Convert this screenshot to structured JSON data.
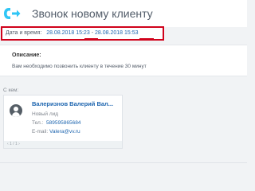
{
  "header": {
    "title": "Звонок новому клиенту",
    "icon": "outgoing-call-icon",
    "icon_color": "#2fc6f6"
  },
  "datetime": {
    "label": "Дата и время:",
    "start_date": "28.08.2018",
    "start_time": "15:23",
    "separator": "-",
    "end_date": "28.08.2018",
    "end_time": "15:53",
    "highlight_color": "#d0021b"
  },
  "description": {
    "label": "Описание:",
    "text": "Вам необходимо позвонить клиенту в течение 30 минут"
  },
  "with": {
    "label": "С кем:"
  },
  "contact": {
    "name": "Валеризнов Валерий Вал...",
    "type": "Новый лид",
    "phone_label": "Тел.:",
    "phone": "589595865684",
    "email_label": "E-mail:",
    "email": "Valera@vv.ru",
    "avatar_icon": "user-avatar-icon"
  },
  "pager": {
    "text": "‹ 1 / 1 ›"
  },
  "colors": {
    "link": "#2067b0",
    "muted": "#80868e",
    "background": "#f1f3f5"
  }
}
